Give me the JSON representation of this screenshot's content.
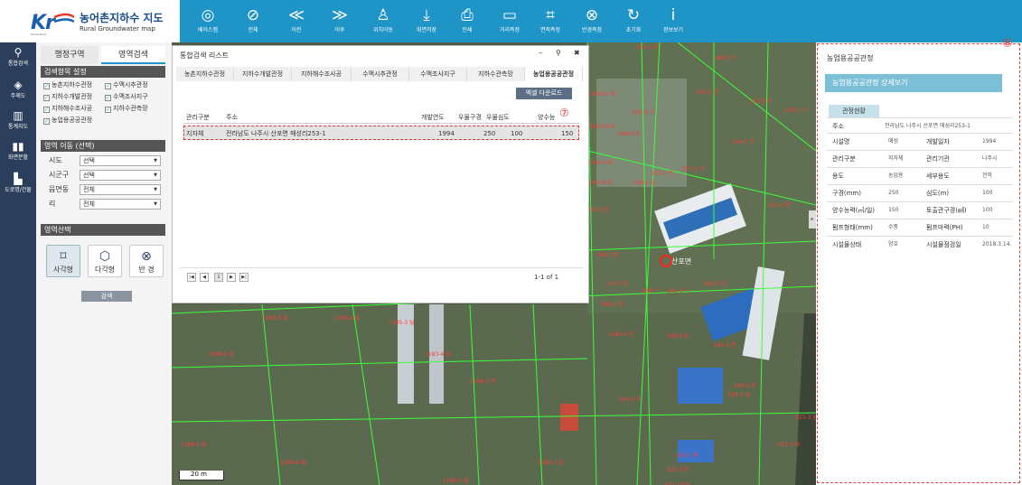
{
  "brand": {
    "mark": "KR",
    "title": "농어촌지하수 지도",
    "subtitle": "Rural Groundwater map",
    "ribbon": "Korea Rural"
  },
  "toolbar": [
    {
      "name": "basemap",
      "label": "베이스맵",
      "icon": "◎"
    },
    {
      "name": "full",
      "label": "전체",
      "icon": "⊘"
    },
    {
      "name": "prev",
      "label": "이전",
      "icon": "≪"
    },
    {
      "name": "next",
      "label": "이후",
      "icon": "≫"
    },
    {
      "name": "locate",
      "label": "위치이동",
      "icon": "♙"
    },
    {
      "name": "save",
      "label": "화면저장",
      "icon": "⤓"
    },
    {
      "name": "print",
      "label": "인쇄",
      "icon": "⎙"
    },
    {
      "name": "distance",
      "label": "거리측정",
      "icon": "▭"
    },
    {
      "name": "area",
      "label": "면적측정",
      "icon": "⌗"
    },
    {
      "name": "radius",
      "label": "반경측정",
      "icon": "⊗"
    },
    {
      "name": "reset",
      "label": "초기화",
      "icon": "↻"
    },
    {
      "name": "info",
      "label": "정보보기",
      "icon": "i"
    }
  ],
  "nav": [
    {
      "label": "통합검색",
      "icon": "⚲"
    },
    {
      "label": "주제도",
      "icon": "◈"
    },
    {
      "label": "통계지도",
      "icon": "▥"
    },
    {
      "label": "화면분할",
      "icon": "▮▮"
    },
    {
      "label": "도로명/건물",
      "icon": "▙"
    }
  ],
  "sidebar": {
    "tab_admin": "행정구역",
    "tab_area": "영역검색",
    "criteria_header": "검색항목 설정",
    "checks": [
      "농촌지하수관정",
      "수맥시추관정",
      "지하수개발관정",
      "수맥조사지구",
      "지하해수조사공",
      "지하수관측망",
      "농업용공공관정"
    ],
    "move_header": "영역 이동 (선택)",
    "fields": [
      {
        "label": "시도",
        "value": "선택"
      },
      {
        "label": "시군구",
        "value": "선택"
      },
      {
        "label": "읍면동",
        "value": "전체"
      },
      {
        "label": "리",
        "value": "전체"
      }
    ],
    "select_header": "영역선택",
    "shapes": [
      {
        "label": "사각형",
        "icon": "⌑"
      },
      {
        "label": "다각형",
        "icon": "⬡"
      },
      {
        "label": "반 경",
        "icon": "⊗"
      }
    ],
    "search_label": "검색"
  },
  "list": {
    "title": "통합검색 리스트",
    "ctrl_min": "–",
    "ctrl_pin": "⚲",
    "ctrl_close": "✖",
    "tabs": [
      "농촌지하수관정",
      "지하수개발관정",
      "지하해수조사공",
      "수맥시추관정",
      "수맥조사지구",
      "지하수관측망",
      "농업용공공관정"
    ],
    "excel": "엑셀 다운로드",
    "headers": [
      "관리구분",
      "주소",
      "개발연도",
      "우물구경",
      "우물심도",
      "양수능"
    ],
    "row": [
      "지자체",
      "전라남도 나주시 산포면 매성리253-1",
      "1994",
      "250",
      "100",
      "150"
    ],
    "marker_row": "⑦",
    "pager": {
      "first": "|◀",
      "prev": "◀",
      "page": "1",
      "next": "▶",
      "last": "▶|",
      "info": "1-1 of 1"
    }
  },
  "map": {
    "scale": "20 m",
    "place": "산포면",
    "parcels": [
      "251-2 전",
      "248-3 구",
      "253-3 전",
      "252-2 구",
      "250-1 전",
      "269-12 대",
      "269-10 대",
      "269-4 도",
      "269-9 대",
      "269-8 대",
      "272-7 전",
      "259-1 답",
      "269-7 답",
      "272-3 전",
      "268 구",
      "268-2 전",
      "262-3 구",
      "262-2 전",
      "269-5 전",
      "261-2 전",
      "260-2 전",
      "1184-4 전",
      "1185-4 답",
      "1185-3 답",
      "1185-5 답",
      "1186-2 전",
      "1188-4 답",
      "1188-2 답",
      "1189-4 답",
      "1183-4 답",
      "1186-3 답",
      "1184-1 답",
      "319-3 답",
      "322-2 장",
      "322-5 전",
      "322-10 전",
      "323-3 대",
      "264-3 도",
      "238-1 답",
      "257-2 구",
      "254-1 전",
      "255-1 구",
      "224-3 전",
      "215-3 답"
    ]
  },
  "detail": {
    "marker": "⑧",
    "title": "농업용공공관정",
    "banner": "농업용공공관정 상세보기",
    "section": "관정현황",
    "address_label": "주소",
    "address_value": "전라남도 나주시 산포면 매성리253-1",
    "rows": [
      [
        "시설명",
        "매성",
        "개발일자",
        "1994"
      ],
      [
        "관리구분",
        "지자체",
        "관리기관",
        "나주시"
      ],
      [
        "용도",
        "농업용",
        "세부용도",
        "전작"
      ],
      [
        "구경(mm)",
        "250",
        "심도(m)",
        "100"
      ],
      [
        "양수능력(㎥/일)",
        "150",
        "토출관구경(㎟)",
        "100"
      ],
      [
        "펌프형태(mm)",
        "수중",
        "펌프마력(PH)",
        "10"
      ],
      [
        "시설물상태",
        "양호",
        "시설물점검일",
        "2018.3.14."
      ]
    ]
  }
}
